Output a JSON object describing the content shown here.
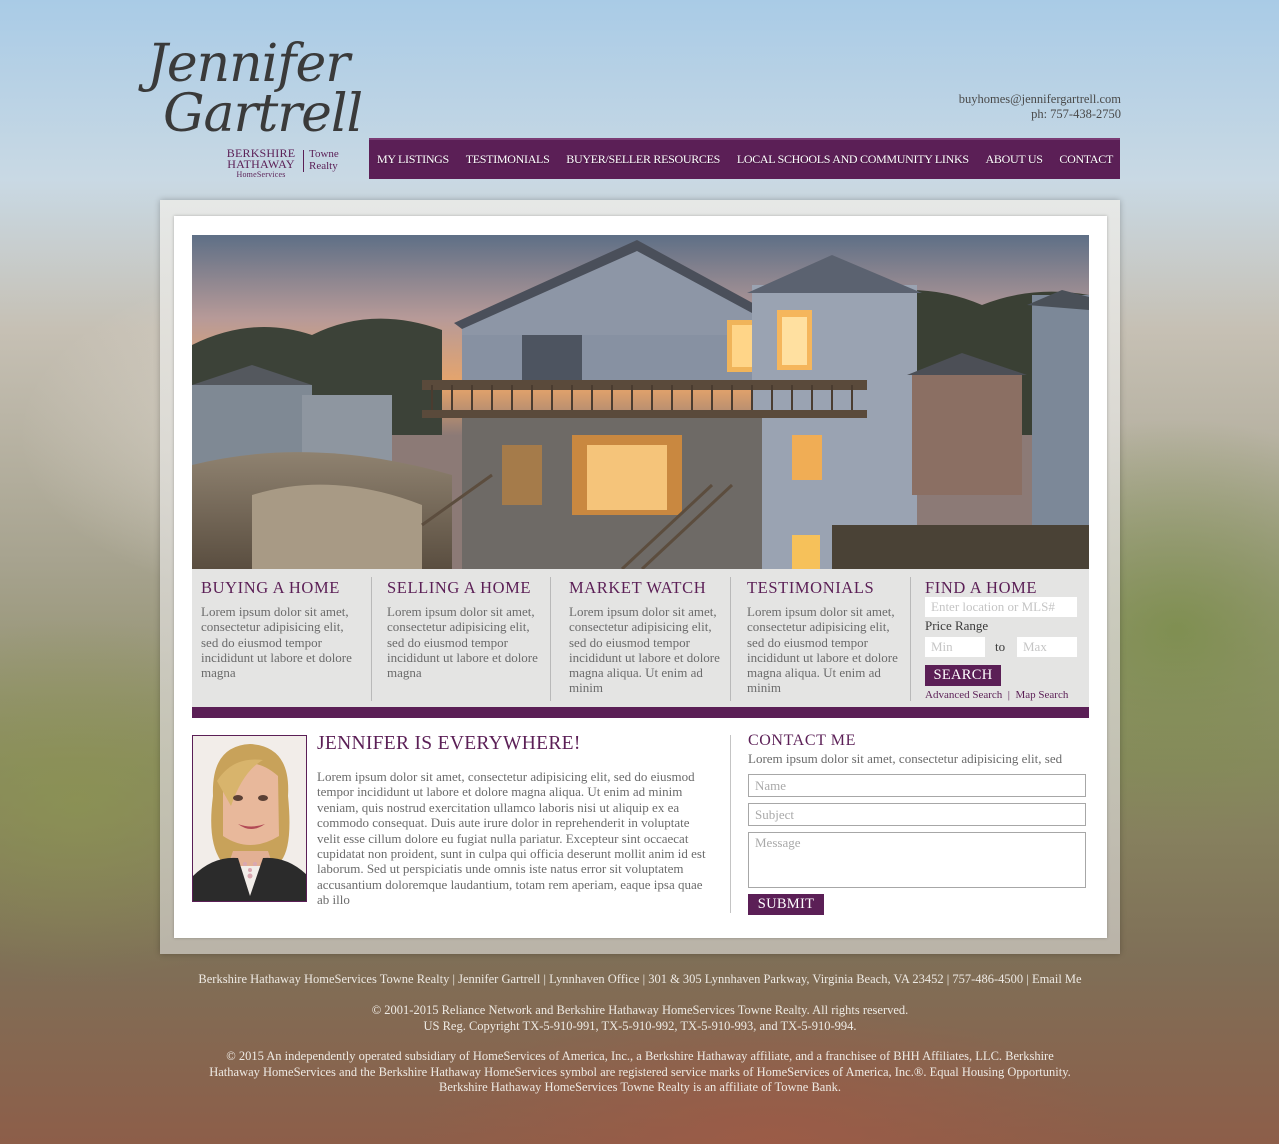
{
  "logo": {
    "first_name": "Jennifer",
    "last_name": "Gartrell",
    "brand_line1": "BERKSHIRE",
    "brand_line2": "HATHAWAY",
    "brand_line3": "HomeServices",
    "office_line1": "Towne",
    "office_line2": "Realty"
  },
  "header": {
    "email": "buyhomes@jennifergartrell.com",
    "phone": "ph: 757-438-2750"
  },
  "nav": [
    {
      "label": "MY LISTINGS"
    },
    {
      "label": "TESTIMONIALS"
    },
    {
      "label": "BUYER/SELLER RESOURCES"
    },
    {
      "label": "LOCAL SCHOOLS AND COMMUNITY LINKS"
    },
    {
      "label": "ABOUT US"
    },
    {
      "label": "CONTACT"
    }
  ],
  "features": [
    {
      "title": "BUYING A HOME",
      "text": "Lorem ipsum dolor sit amet, consectetur adipisicing elit, sed do eiusmod tempor incididunt ut labore et dolore magna"
    },
    {
      "title": "SELLING A HOME",
      "text": "Lorem ipsum dolor sit amet, consectetur adipisicing elit, sed do eiusmod tempor incididunt ut labore et dolore magna"
    },
    {
      "title": "MARKET WATCH",
      "text": "Lorem ipsum dolor sit amet, consectetur adipisicing elit, sed do eiusmod tempor incididunt ut labore et dolore magna aliqua. Ut enim ad minim"
    },
    {
      "title": "TESTIMONIALS",
      "text": "Lorem ipsum dolor sit amet, consectetur adipisicing elit, sed do eiusmod tempor incididunt ut labore et dolore magna aliqua. Ut enim ad minim"
    }
  ],
  "find_home": {
    "title": "FIND A HOME",
    "location_placeholder": "Enter location or MLS#",
    "price_range_label": "Price Range",
    "min_placeholder": "Min",
    "to_label": "to",
    "max_placeholder": "Max",
    "search_label": "SEARCH",
    "advanced_search": "Advanced Search",
    "separator": "|",
    "map_search": "Map Search"
  },
  "about": {
    "title": "JENNIFER IS EVERYWHERE!",
    "text": "Lorem ipsum dolor sit amet, consectetur adipisicing elit, sed do eiusmod tempor incididunt ut labore et dolore magna aliqua. Ut enim ad minim veniam, quis nostrud exercitation ullamco laboris nisi ut aliquip ex ea commodo consequat. Duis aute irure dolor in reprehenderit in voluptate velit esse cillum dolore eu fugiat nulla pariatur. Excepteur sint occaecat cupidatat non proident, sunt in culpa qui officia deserunt mollit anim id est laborum. Sed ut perspiciatis unde omnis iste natus error sit voluptatem accusantium doloremque laudantium, totam rem aperiam, eaque ipsa quae ab illo"
  },
  "contact": {
    "title": "CONTACT ME",
    "description": "Lorem ipsum dolor sit amet, consectetur adipisicing elit, sed",
    "name_placeholder": "Name",
    "subject_placeholder": "Subject",
    "message_placeholder": "Message",
    "submit_label": "SUBMIT"
  },
  "footer": {
    "address_line": "Berkshire Hathaway HomeServices Towne Realty | Jennifer Gartrell | Lynnhaven Office | 301 & 305 Lynnhaven Parkway, Virginia Beach, VA 23452 | 757-486-4500 |",
    "email_link": "Email Me",
    "copyright_line1": "© 2001-2015 Reliance Network and Berkshire Hathaway HomeServices Towne Realty. All rights reserved.",
    "copyright_line2": "US Reg. Copyright TX-5-910-991, TX-5-910-992, TX-5-910-993, and TX-5-910-994.",
    "legal_line1": "© 2015 An independently operated subsidiary of HomeServices of America, Inc., a Berkshire Hathaway affiliate, and a franchisee of BHH Affiliates, LLC. Berkshire",
    "legal_line2": "Hathaway HomeServices and the Berkshire Hathaway HomeServices symbol are registered service marks of HomeServices of America, Inc.®.  Equal Housing Opportunity.",
    "legal_line3": "Berkshire Hathaway HomeServices Towne Realty is an affiliate of Towne Bank."
  },
  "colors": {
    "brand_purple": "#5b1f56",
    "feature_bg": "#e4e4e3",
    "body_text": "#6b6b6b"
  }
}
